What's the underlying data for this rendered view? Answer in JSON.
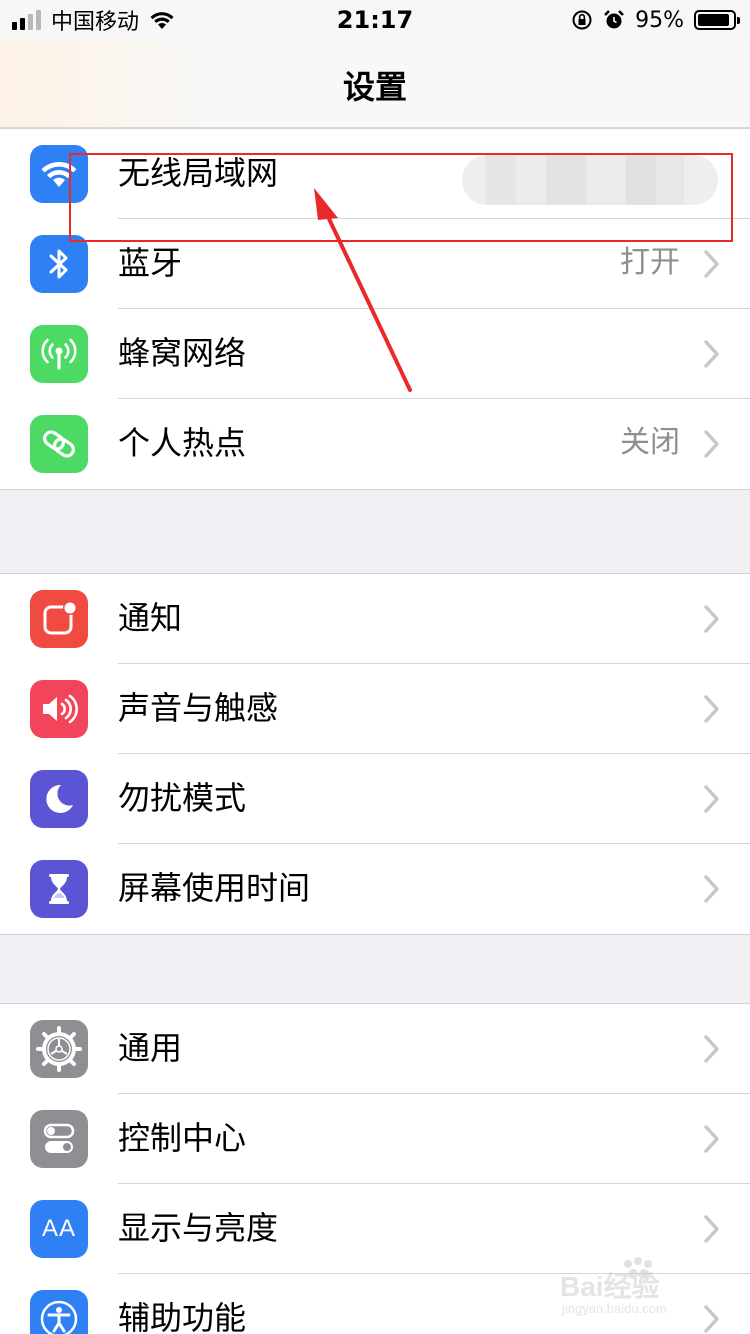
{
  "status_bar": {
    "carrier": "中国移动",
    "time": "21:17",
    "battery_percent": "95%",
    "battery_level": 0.95,
    "signal_bars_filled": 2,
    "signal_bars_total": 4
  },
  "nav": {
    "title": "设置"
  },
  "groups": [
    {
      "items": [
        {
          "label": "无线局域网",
          "value": "",
          "icon": "wifi-icon",
          "color": "#2f80f5"
        },
        {
          "label": "蓝牙",
          "value": "打开",
          "icon": "bluetooth-icon",
          "color": "#2f80f5"
        },
        {
          "label": "蜂窝网络",
          "value": "",
          "icon": "antenna-icon",
          "color": "#4cd964"
        },
        {
          "label": "个人热点",
          "value": "关闭",
          "icon": "chain-link-icon",
          "color": "#4cd964"
        }
      ]
    },
    {
      "items": [
        {
          "label": "通知",
          "value": "",
          "icon": "notification-icon",
          "color": "#f04b40"
        },
        {
          "label": "声音与触感",
          "value": "",
          "icon": "speaker-icon",
          "color": "#f2455c"
        },
        {
          "label": "勿扰模式",
          "value": "",
          "icon": "moon-icon",
          "color": "#5b55d6"
        },
        {
          "label": "屏幕使用时间",
          "value": "",
          "icon": "hourglass-icon",
          "color": "#5b55d6"
        }
      ]
    },
    {
      "items": [
        {
          "label": "通用",
          "value": "",
          "icon": "gear-icon",
          "color": "#8e8e93"
        },
        {
          "label": "控制中心",
          "value": "",
          "icon": "toggles-icon",
          "color": "#8e8e93"
        },
        {
          "label": "显示与亮度",
          "value": "",
          "icon": "text-size-icon",
          "color": "#2f80f5"
        },
        {
          "label": "辅助功能",
          "value": "",
          "icon": "accessibility-icon",
          "color": "#2f80f5"
        }
      ]
    }
  ],
  "icon_text": {
    "display_aa": "AA"
  },
  "watermark": {
    "text": "Bai经验",
    "subtext": "jingyan.baidu.com"
  },
  "annotation_color": "#e82a2a"
}
